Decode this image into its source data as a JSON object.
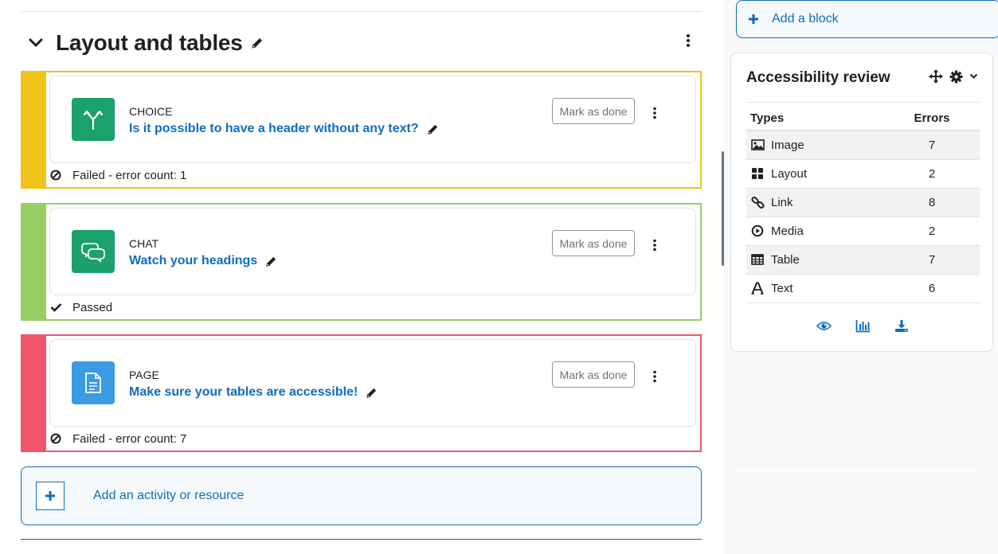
{
  "section": {
    "title": "Layout and tables"
  },
  "activities": [
    {
      "type": "CHOICE",
      "name": "Is it possible to have a header without any text?",
      "mark_label": "Mark as done",
      "status": "Failed - error count: 1",
      "status_icon": "ban-icon",
      "activity_icon": "choice-icon",
      "icon_color": "#1ba16a",
      "border_color": "#f0c419"
    },
    {
      "type": "CHAT",
      "name": "Watch your headings",
      "mark_label": "Mark as done",
      "status": "Passed",
      "status_icon": "check-icon",
      "activity_icon": "chat-icon",
      "icon_color": "#1ba16a",
      "border_color": "#98ce64"
    },
    {
      "type": "PAGE",
      "name": "Make sure your tables are accessible!",
      "mark_label": "Mark as done",
      "status": "Failed - error count: 7",
      "status_icon": "ban-icon",
      "activity_icon": "page-icon",
      "icon_color": "#399be2",
      "border_color": "#f0556b"
    }
  ],
  "add_activity": {
    "label": "Add an activity or resource"
  },
  "sidebar": {
    "add_block_label": "Add a block",
    "block": {
      "title": "Accessibility review",
      "columns": [
        "Types",
        "Errors"
      ],
      "rows": [
        {
          "type": "Image",
          "errors": "7",
          "icon": "image-icon"
        },
        {
          "type": "Layout",
          "errors": "2",
          "icon": "layout-icon"
        },
        {
          "type": "Link",
          "errors": "8",
          "icon": "link-icon"
        },
        {
          "type": "Media",
          "errors": "2",
          "icon": "media-icon"
        },
        {
          "type": "Table",
          "errors": "7",
          "icon": "table-icon"
        },
        {
          "type": "Text",
          "errors": "6",
          "icon": "text-icon"
        }
      ],
      "actions": [
        "eye-icon",
        "bar-chart-icon",
        "download-icon"
      ]
    }
  },
  "colors": {
    "link": "#0f6cbf",
    "text": "#1d2125"
  }
}
